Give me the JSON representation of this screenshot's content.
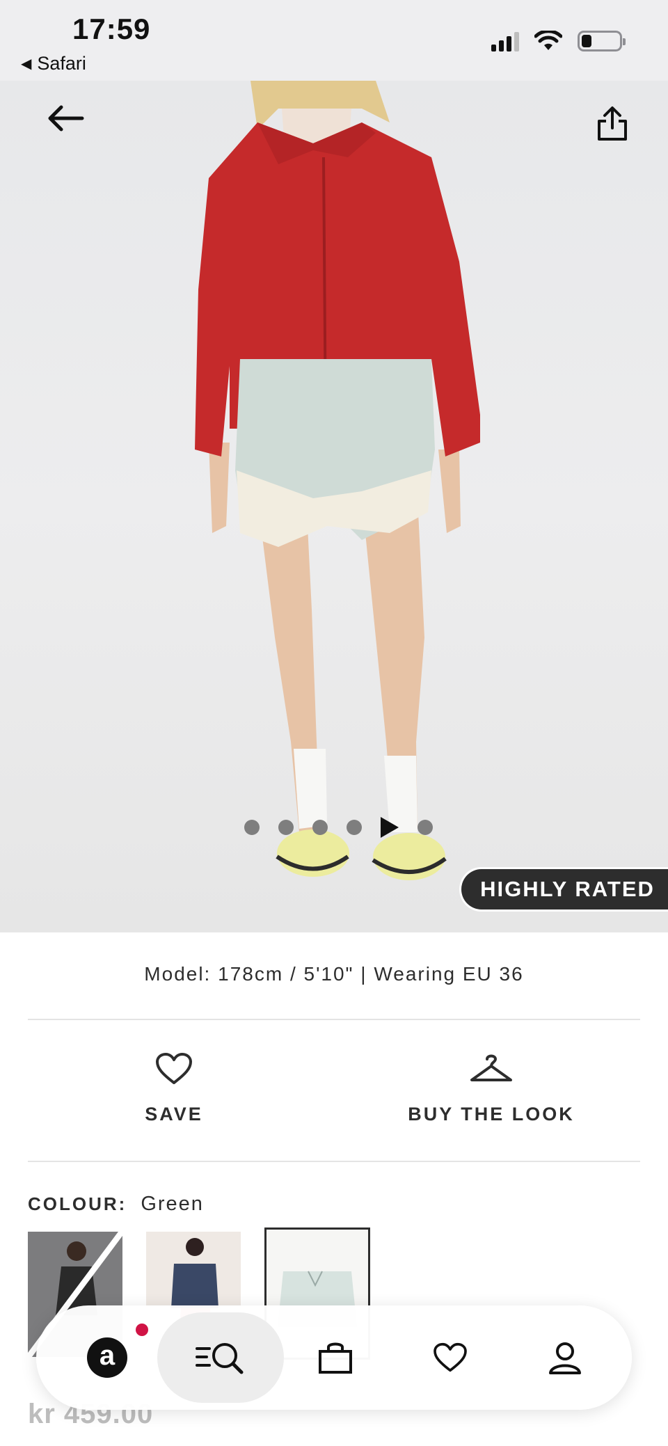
{
  "status_bar": {
    "time": "17:59",
    "back_app": "Safari",
    "signal_icon": "cellular-signal-icon",
    "wifi_icon": "wifi-icon",
    "battery_icon": "battery-low-icon",
    "battery_level": 0.2
  },
  "hero": {
    "back_icon": "arrow-left-icon",
    "share_icon": "share-icon",
    "carousel_total": 6,
    "carousel_active_index": 4,
    "badge": "HIGHLY RATED"
  },
  "product": {
    "model_info": "Model: 178cm / 5'10\" | Wearing EU 36",
    "colour_label": "COLOUR:",
    "colour_value": "Green",
    "price": "kr 459.00"
  },
  "actions": {
    "save_label": "SAVE",
    "save_icon": "heart-icon",
    "buy_look_label": "BUY THE LOOK",
    "buy_look_icon": "hanger-icon"
  },
  "bottom_nav": {
    "home_letter": "a",
    "items": [
      "home-icon",
      "search-icon",
      "bag-icon",
      "heart-icon",
      "account-icon"
    ],
    "accent": "#d01345"
  }
}
